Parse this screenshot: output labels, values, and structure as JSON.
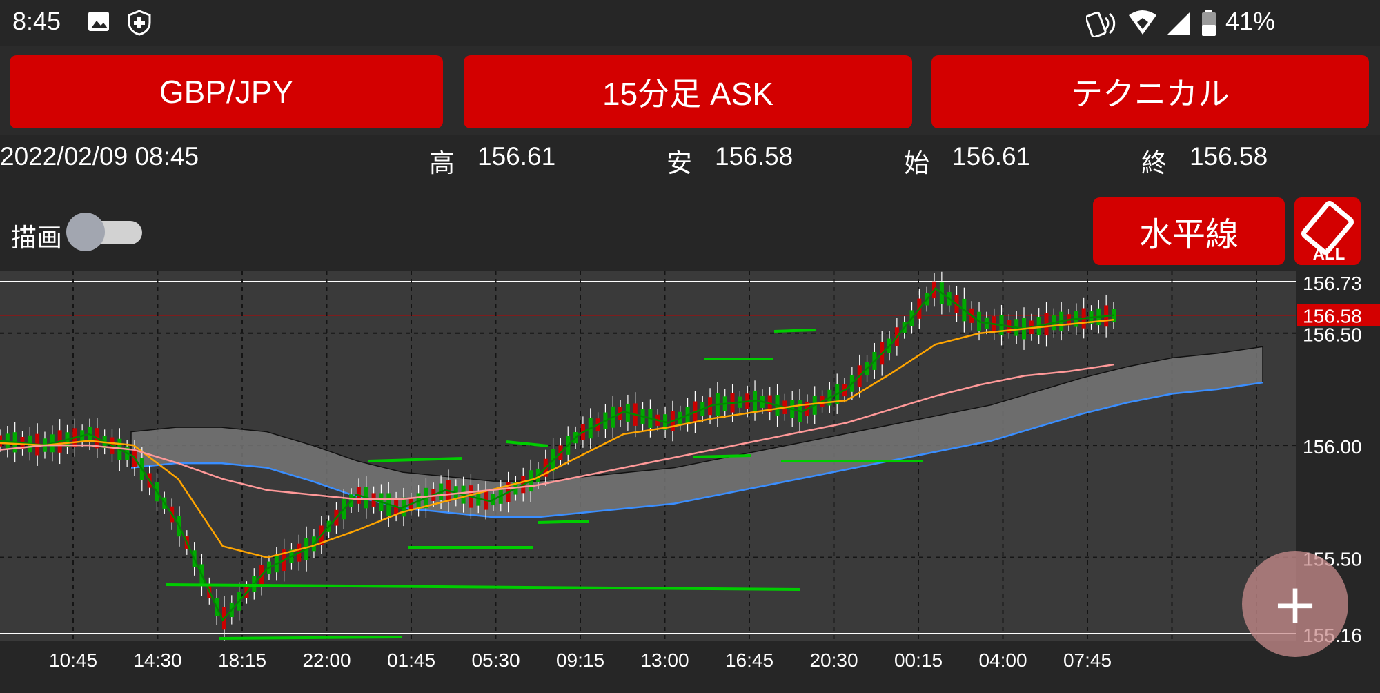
{
  "status_bar": {
    "time": "8:45",
    "battery_percent": "41%",
    "icons": [
      "image-icon",
      "shield-icon",
      "nfc-icon",
      "wifi-icon",
      "signal-icon",
      "battery-icon"
    ]
  },
  "toolbar": {
    "pair_label": "GBP/JPY",
    "timeframe_label": "15分足 ASK",
    "technical_label": "テクニカル"
  },
  "info": {
    "datetime": "2022/02/09 08:45",
    "high_label": "高",
    "high_value": "156.61",
    "low_label": "安",
    "low_value": "156.58",
    "open_label": "始",
    "open_value": "156.61",
    "close_label": "終",
    "close_value": "156.58"
  },
  "drawing": {
    "label": "描画",
    "toggle_on": false,
    "horizontal_line_label": "水平線",
    "clear_all_label": "ALL"
  },
  "colors": {
    "accent_red": "#d30000",
    "up_candle": "#00aa00",
    "down_candle": "#cc0000",
    "drawn_line": "#00cc00",
    "ma_short": "#008800",
    "ma_mid": "#ffa500",
    "ma_long": "#ff9999",
    "ichimoku_line": "#3a8eff"
  },
  "chart_data": {
    "type": "line",
    "x_ticks": [
      "10:45",
      "14:30",
      "18:15",
      "22:00",
      "01:45",
      "05:30",
      "09:15",
      "13:00",
      "16:45",
      "20:30",
      "00:15",
      "04:00",
      "07:45"
    ],
    "y_ticks": [
      "156.73",
      "156.50",
      "156.00",
      "155.50",
      "155.16"
    ],
    "ylim": [
      155.16,
      156.73
    ],
    "current_price_label": "156.58",
    "current_price": 156.58,
    "series": [
      {
        "values": [
          156.02,
          156.0,
          156.05,
          155.95,
          155.65,
          155.22,
          155.45,
          155.55,
          155.78,
          155.72,
          155.8,
          155.75,
          155.85,
          156.05,
          156.15,
          156.1,
          156.18,
          156.2,
          156.15,
          156.25,
          156.45,
          156.7,
          156.55,
          156.52,
          156.56,
          156.58
        ]
      },
      {
        "values": [
          156.01,
          156.0,
          156.02,
          156.0,
          155.85,
          155.55,
          155.5,
          155.55,
          155.62,
          155.7,
          155.75,
          155.8,
          155.85,
          155.95,
          156.05,
          156.08,
          156.12,
          156.15,
          156.18,
          156.2,
          156.32,
          156.45,
          156.5,
          156.52,
          156.54,
          156.56
        ]
      },
      {
        "values": [
          155.98,
          156.0,
          156.0,
          155.98,
          155.92,
          155.85,
          155.8,
          155.78,
          155.76,
          155.76,
          155.78,
          155.8,
          155.82,
          155.86,
          155.9,
          155.94,
          155.98,
          156.02,
          156.06,
          156.1,
          156.16,
          156.22,
          156.27,
          156.31,
          156.33,
          156.36
        ]
      }
    ]
  }
}
